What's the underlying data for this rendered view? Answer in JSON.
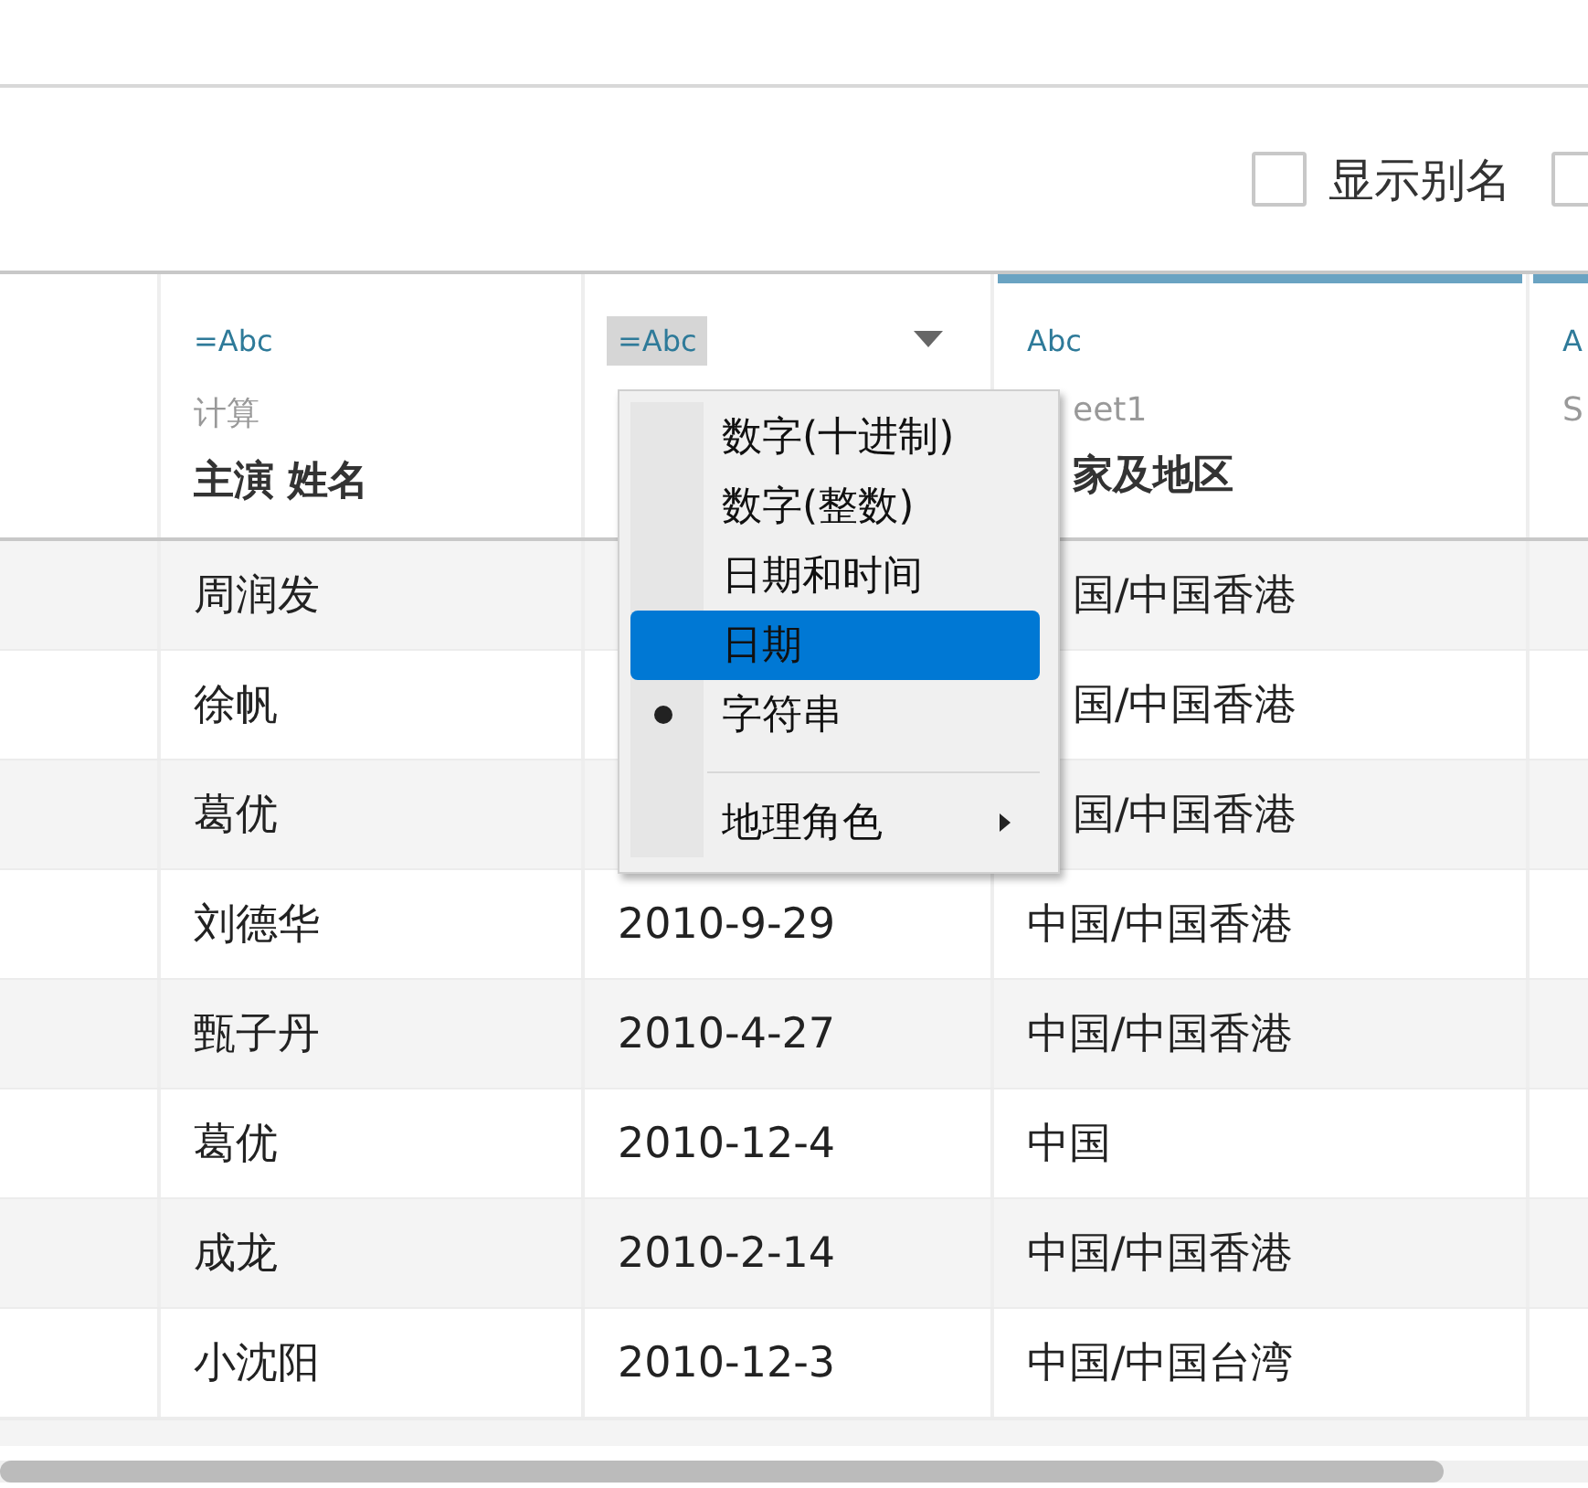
{
  "toolbar": {
    "checkboxes": [
      {
        "label": "显示别名",
        "checked": false
      },
      {
        "checked": false
      }
    ]
  },
  "columns": [
    {
      "type_label": "=Abc",
      "source": "计算",
      "name": "主演 姓名",
      "accent": false,
      "menu_open": false
    },
    {
      "type_label": "=Abc",
      "accent": false,
      "menu_open": true
    },
    {
      "type_label": "Abc",
      "source": "eet1",
      "name": "家及地区",
      "accent": true,
      "menu_open": false
    },
    {
      "type_label": "A",
      "source": "S",
      "accent": true,
      "menu_open": false
    }
  ],
  "rows": [
    {
      "cells": [
        "周润发",
        null,
        "国/中国香港"
      ]
    },
    {
      "cells": [
        "徐帆",
        null,
        "国/中国香港"
      ]
    },
    {
      "cells": [
        "葛优",
        null,
        "国/中国香港"
      ]
    },
    {
      "cells": [
        "刘德华",
        "2010-9-29",
        "中国/中国香港"
      ]
    },
    {
      "cells": [
        "甄子丹",
        "2010-4-27",
        "中国/中国香港"
      ]
    },
    {
      "cells": [
        "葛优",
        "2010-12-4",
        "中国"
      ]
    },
    {
      "cells": [
        "成龙",
        "2010-2-14",
        "中国/中国香港"
      ]
    },
    {
      "cells": [
        "小沈阳",
        "2010-12-3",
        "中国/中国台湾"
      ]
    }
  ],
  "menu": {
    "items": [
      {
        "kind": "option",
        "label": "数字(十进制)",
        "selected": false,
        "checked": false
      },
      {
        "kind": "option",
        "label": "数字(整数)",
        "selected": false,
        "checked": false
      },
      {
        "kind": "option",
        "label": "日期和时间",
        "selected": false,
        "checked": false
      },
      {
        "kind": "option",
        "label": "日期",
        "selected": true,
        "checked": false
      },
      {
        "kind": "option",
        "label": "字符串",
        "selected": false,
        "checked": true
      },
      {
        "kind": "separator"
      },
      {
        "kind": "submenu",
        "label": "地理角色",
        "selected": false
      }
    ]
  }
}
